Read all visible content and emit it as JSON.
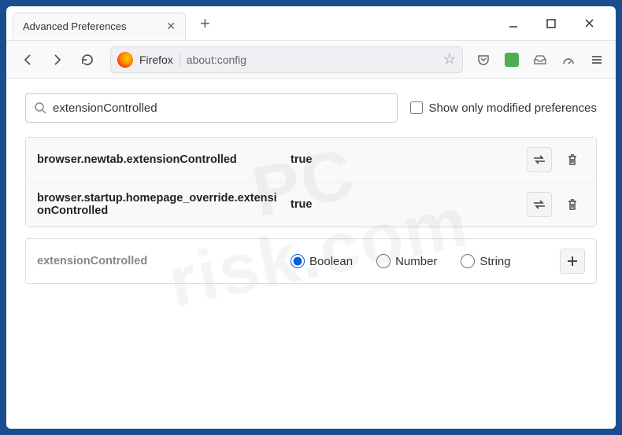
{
  "tab": {
    "title": "Advanced Preferences"
  },
  "addressbar": {
    "label": "Firefox",
    "url": "about:config"
  },
  "search": {
    "value": "extensionControlled",
    "checkbox_label": "Show only modified preferences"
  },
  "prefs": [
    {
      "name": "browser.newtab.extensionControlled",
      "value": "true"
    },
    {
      "name": "browser.startup.homepage_override.extensionControlled",
      "value": "true"
    }
  ],
  "new_pref": {
    "name": "extensionControlled",
    "types": [
      "Boolean",
      "Number",
      "String"
    ],
    "selected": "Boolean"
  }
}
